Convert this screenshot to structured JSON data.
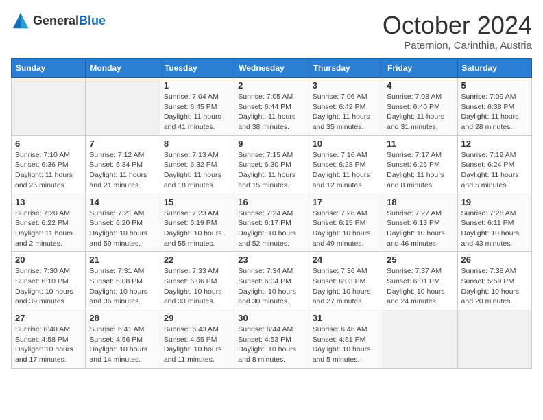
{
  "logo": {
    "general": "General",
    "blue": "Blue"
  },
  "header": {
    "month": "October 2024",
    "location": "Paternion, Carinthia, Austria"
  },
  "weekdays": [
    "Sunday",
    "Monday",
    "Tuesday",
    "Wednesday",
    "Thursday",
    "Friday",
    "Saturday"
  ],
  "weeks": [
    [
      {
        "day": "",
        "info": ""
      },
      {
        "day": "",
        "info": ""
      },
      {
        "day": "1",
        "info": "Sunrise: 7:04 AM\nSunset: 6:45 PM\nDaylight: 11 hours and 41 minutes."
      },
      {
        "day": "2",
        "info": "Sunrise: 7:05 AM\nSunset: 6:44 PM\nDaylight: 11 hours and 38 minutes."
      },
      {
        "day": "3",
        "info": "Sunrise: 7:06 AM\nSunset: 6:42 PM\nDaylight: 11 hours and 35 minutes."
      },
      {
        "day": "4",
        "info": "Sunrise: 7:08 AM\nSunset: 6:40 PM\nDaylight: 11 hours and 31 minutes."
      },
      {
        "day": "5",
        "info": "Sunrise: 7:09 AM\nSunset: 6:38 PM\nDaylight: 11 hours and 28 minutes."
      }
    ],
    [
      {
        "day": "6",
        "info": "Sunrise: 7:10 AM\nSunset: 6:36 PM\nDaylight: 11 hours and 25 minutes."
      },
      {
        "day": "7",
        "info": "Sunrise: 7:12 AM\nSunset: 6:34 PM\nDaylight: 11 hours and 21 minutes."
      },
      {
        "day": "8",
        "info": "Sunrise: 7:13 AM\nSunset: 6:32 PM\nDaylight: 11 hours and 18 minutes."
      },
      {
        "day": "9",
        "info": "Sunrise: 7:15 AM\nSunset: 6:30 PM\nDaylight: 11 hours and 15 minutes."
      },
      {
        "day": "10",
        "info": "Sunrise: 7:16 AM\nSunset: 6:28 PM\nDaylight: 11 hours and 12 minutes."
      },
      {
        "day": "11",
        "info": "Sunrise: 7:17 AM\nSunset: 6:26 PM\nDaylight: 11 hours and 8 minutes."
      },
      {
        "day": "12",
        "info": "Sunrise: 7:19 AM\nSunset: 6:24 PM\nDaylight: 11 hours and 5 minutes."
      }
    ],
    [
      {
        "day": "13",
        "info": "Sunrise: 7:20 AM\nSunset: 6:22 PM\nDaylight: 11 hours and 2 minutes."
      },
      {
        "day": "14",
        "info": "Sunrise: 7:21 AM\nSunset: 6:20 PM\nDaylight: 10 hours and 59 minutes."
      },
      {
        "day": "15",
        "info": "Sunrise: 7:23 AM\nSunset: 6:19 PM\nDaylight: 10 hours and 55 minutes."
      },
      {
        "day": "16",
        "info": "Sunrise: 7:24 AM\nSunset: 6:17 PM\nDaylight: 10 hours and 52 minutes."
      },
      {
        "day": "17",
        "info": "Sunrise: 7:26 AM\nSunset: 6:15 PM\nDaylight: 10 hours and 49 minutes."
      },
      {
        "day": "18",
        "info": "Sunrise: 7:27 AM\nSunset: 6:13 PM\nDaylight: 10 hours and 46 minutes."
      },
      {
        "day": "19",
        "info": "Sunrise: 7:28 AM\nSunset: 6:11 PM\nDaylight: 10 hours and 43 minutes."
      }
    ],
    [
      {
        "day": "20",
        "info": "Sunrise: 7:30 AM\nSunset: 6:10 PM\nDaylight: 10 hours and 39 minutes."
      },
      {
        "day": "21",
        "info": "Sunrise: 7:31 AM\nSunset: 6:08 PM\nDaylight: 10 hours and 36 minutes."
      },
      {
        "day": "22",
        "info": "Sunrise: 7:33 AM\nSunset: 6:06 PM\nDaylight: 10 hours and 33 minutes."
      },
      {
        "day": "23",
        "info": "Sunrise: 7:34 AM\nSunset: 6:04 PM\nDaylight: 10 hours and 30 minutes."
      },
      {
        "day": "24",
        "info": "Sunrise: 7:36 AM\nSunset: 6:03 PM\nDaylight: 10 hours and 27 minutes."
      },
      {
        "day": "25",
        "info": "Sunrise: 7:37 AM\nSunset: 6:01 PM\nDaylight: 10 hours and 24 minutes."
      },
      {
        "day": "26",
        "info": "Sunrise: 7:38 AM\nSunset: 5:59 PM\nDaylight: 10 hours and 20 minutes."
      }
    ],
    [
      {
        "day": "27",
        "info": "Sunrise: 6:40 AM\nSunset: 4:58 PM\nDaylight: 10 hours and 17 minutes."
      },
      {
        "day": "28",
        "info": "Sunrise: 6:41 AM\nSunset: 4:56 PM\nDaylight: 10 hours and 14 minutes."
      },
      {
        "day": "29",
        "info": "Sunrise: 6:43 AM\nSunset: 4:55 PM\nDaylight: 10 hours and 11 minutes."
      },
      {
        "day": "30",
        "info": "Sunrise: 6:44 AM\nSunset: 4:53 PM\nDaylight: 10 hours and 8 minutes."
      },
      {
        "day": "31",
        "info": "Sunrise: 6:46 AM\nSunset: 4:51 PM\nDaylight: 10 hours and 5 minutes."
      },
      {
        "day": "",
        "info": ""
      },
      {
        "day": "",
        "info": ""
      }
    ]
  ]
}
